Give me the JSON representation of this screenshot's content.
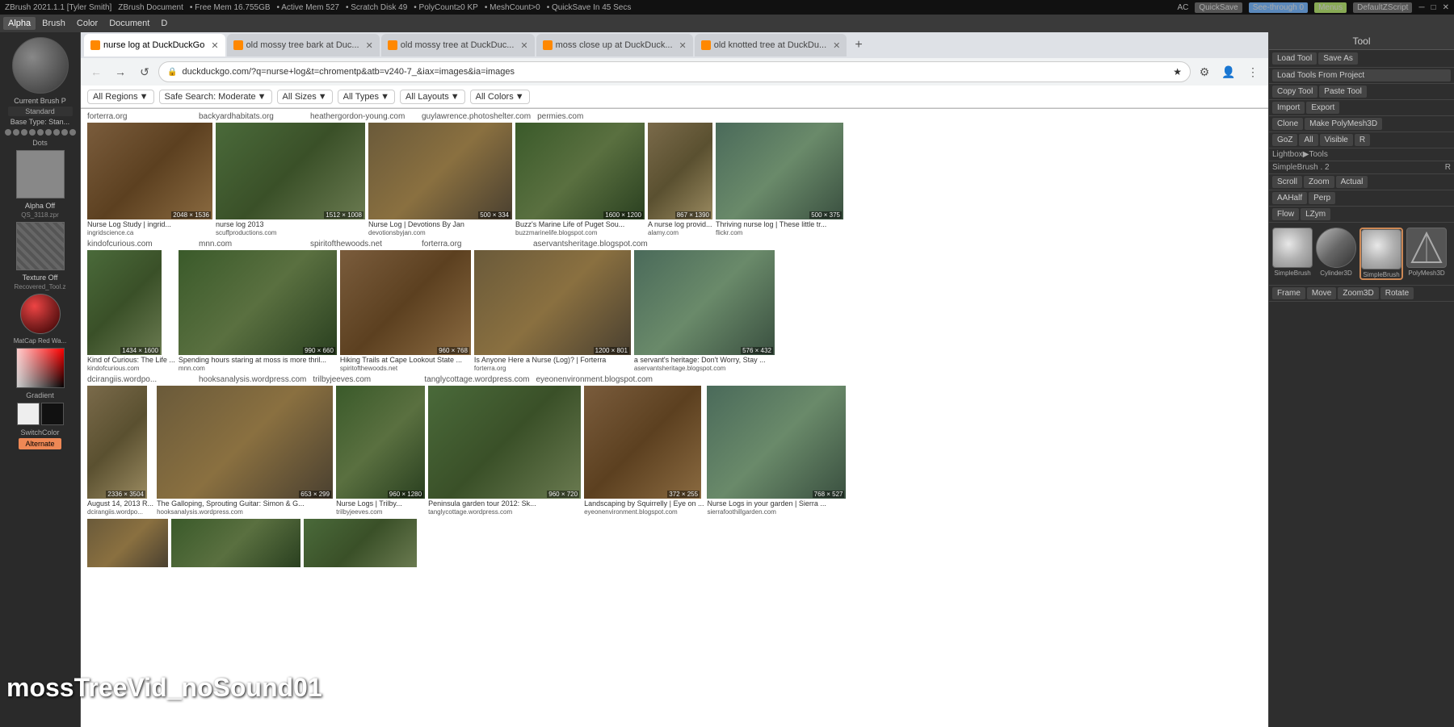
{
  "system_bar": {
    "title": "ZBrush 2021.1.1 [Tyler Smith]",
    "doc": "ZBrush Document",
    "free_mem": "• Free Mem 16.755GB",
    "active_mem": "• Active Mem 527",
    "scratch_disk": "• Scratch Disk 49",
    "poly_count": "• PolyCount≥0 KP",
    "mesh_count": "• MeshCount>0",
    "quick_save": "• QuickSave In 45 Secs",
    "ac": "AC",
    "quick_save_btn": "QuickSave",
    "see_through": "See-through 0",
    "menus": "Menus",
    "default_z": "DefaultZScript"
  },
  "zbrush_menu": {
    "items": [
      "Alpha",
      "Brush",
      "Color",
      "Document",
      "D"
    ]
  },
  "left_panel": {
    "brush_label": "Current Brush P",
    "standard": "Standard",
    "base_type": "Base Type: Stan...",
    "dots_label": "Dots",
    "alpha_label": "Alpha Off",
    "alpha_file": "QS_3118.zpr",
    "texture_label": "Texture Off",
    "texture_file": "Recovered_Tool.z",
    "matcap_label": "MatCap Red Wa...",
    "gradient_label": "Gradient",
    "switch_color": "SwitchColor",
    "alternate": "Alternate"
  },
  "browser": {
    "tabs": [
      {
        "label": "nurse log at DuckDuckGo",
        "active": true,
        "favicon_color": "#f80"
      },
      {
        "label": "old mossy tree bark at Duc...",
        "active": false,
        "favicon_color": "#f80"
      },
      {
        "label": "old mossy tree at DuckDuc...",
        "active": false,
        "favicon_color": "#f80"
      },
      {
        "label": "moss close up at DuckDuck...",
        "active": false,
        "favicon_color": "#f80"
      },
      {
        "label": "old knotted tree at DuckDu...",
        "active": false,
        "favicon_color": "#f80"
      }
    ],
    "address": "duckduckgo.com/?q=nurse+log&t=chromentp&atb=v240-7_&iax=images&ia=images",
    "filters": [
      "All Regions",
      "Safe Search: Moderate",
      "All Sizes",
      "All Types",
      "All Layouts",
      "All Colors"
    ],
    "site_labels": [
      "forterra.org",
      "backyardhabitats.org",
      "heathergordon-young.com",
      "guylawrence.photoshelter.com",
      "permies.com"
    ],
    "site_labels2": [
      "kindofcurious.com",
      "mnn.com",
      "spiritofthewoods.net",
      "forterra.org",
      "aservantsheritage.blogspot.com"
    ],
    "site_labels3": [
      "dcirangiis.wordpo...",
      "hooksanalysis.wordpress.com",
      "trilbyjeeves.com",
      "tanglycottage.wordpress.com",
      "eyeonenvironment.blogspot.com",
      "sierrafoothillgarden.com"
    ],
    "row1": [
      {
        "dims": "2048 × 1536",
        "title": "Nurse Log Study | ingrid...",
        "site": "ingridscience.ca"
      },
      {
        "dims": "1512 × 1008",
        "title": "nurse log 2013",
        "site": "scuffproductions.com"
      },
      {
        "dims": "500 × 334",
        "title": "Nurse Log | Devotions By Jan",
        "site": "devotionsbyjan.com"
      },
      {
        "dims": "1600 × 1200",
        "title": "Buzz's Marine Life of Puget Sou...",
        "site": "buzzmarinelife.blogspot.com"
      },
      {
        "dims": "867 × 1390",
        "title": "A nurse log provid...",
        "site": "alamy.com"
      },
      {
        "dims": "500 × 375",
        "title": "Thriving nurse log | These little tr...",
        "site": "flickr.com"
      }
    ],
    "row2": [
      {
        "dims": "1434 × 1600",
        "title": "Kind of Curious: The Life ...",
        "site": "kindofcurious.com"
      },
      {
        "dims": "990 × 660",
        "title": "Spending hours staring at moss is more thril...",
        "site": "mnn.com"
      },
      {
        "dims": "960 × 768",
        "title": "Hiking Trails at Cape Lookout State ...",
        "site": "spiritofthewoods.net"
      },
      {
        "dims": "1200 × 801",
        "title": "Is Anyone Here a Nurse (Log)? | Forterra",
        "site": "forterra.org"
      },
      {
        "dims": "576 × 432",
        "title": "a servant's heritage: Don't Worry, Stay ...",
        "site": "aservantsheritage.blogspot.com"
      }
    ],
    "row3": [
      {
        "dims": "2336 × 3504",
        "title": "August 14, 2013 R...",
        "site": "dcirangiis.wordpo..."
      },
      {
        "dims": "653 × 299",
        "title": "The Galloping, Sprouting Guitar: Simon & G...",
        "site": "hooksanalysis.wordpress.com"
      },
      {
        "dims": "960 × 1280",
        "title": "Nurse Logs | Trilby...",
        "site": "trilbyjeeves.com"
      },
      {
        "dims": "960 × 720",
        "title": "Peninsula garden tour 2012: Sk...",
        "site": "tanglycottage.wordpress.com"
      },
      {
        "dims": "372 × 255",
        "title": "Landscaping by Squirrelly | Eye on ...",
        "site": "eyeonenvironment.blogspot.com"
      },
      {
        "dims": "768 × 527",
        "title": "Nurse Logs in your garden | Sierra ...",
        "site": "sierrafoothillgarden.com"
      }
    ]
  },
  "right_panel": {
    "header": "Tool",
    "load_tool": "Load Tool",
    "save_as": "Save As",
    "load_tools_project": "Load Tools From Project",
    "copy_tool": "Copy Tool",
    "paste_tool": "Paste Tool",
    "import": "Import",
    "export": "Export",
    "clone": "Clone",
    "make_polymesh": "Make PolyMesh3D",
    "goz": "GoZ",
    "all": "All",
    "visible": "Visible",
    "r": "R",
    "lightbox_tools": "Lightbox▶Tools",
    "simple_brush_count": "SimpleBrush . 2",
    "r2": "R",
    "scroll": "Scroll",
    "zoom": "Zoom",
    "actual": "Actual",
    "aahalf": "AAHalf",
    "perp": "Perp",
    "flow": "Flow",
    "lzym": "LZym",
    "frame": "Frame",
    "move": "Move",
    "zoom3d": "Zoom3D",
    "rotate": "Rotate",
    "tool_items": [
      {
        "label": "SimpleBrush",
        "type": "brush"
      },
      {
        "label": "Cylinder3D",
        "type": "cylinder"
      },
      {
        "label": "SimpleBrush",
        "type": "brush2"
      },
      {
        "label": "PolyMesh3D",
        "type": "poly"
      }
    ]
  },
  "bottom_text": "mossTreeVid_noSound01",
  "icons": {
    "back": "←",
    "forward": "→",
    "refresh": "↺",
    "star": "★",
    "lock": "🔒",
    "dropdown": "▼",
    "close": "✕",
    "add": "+"
  }
}
